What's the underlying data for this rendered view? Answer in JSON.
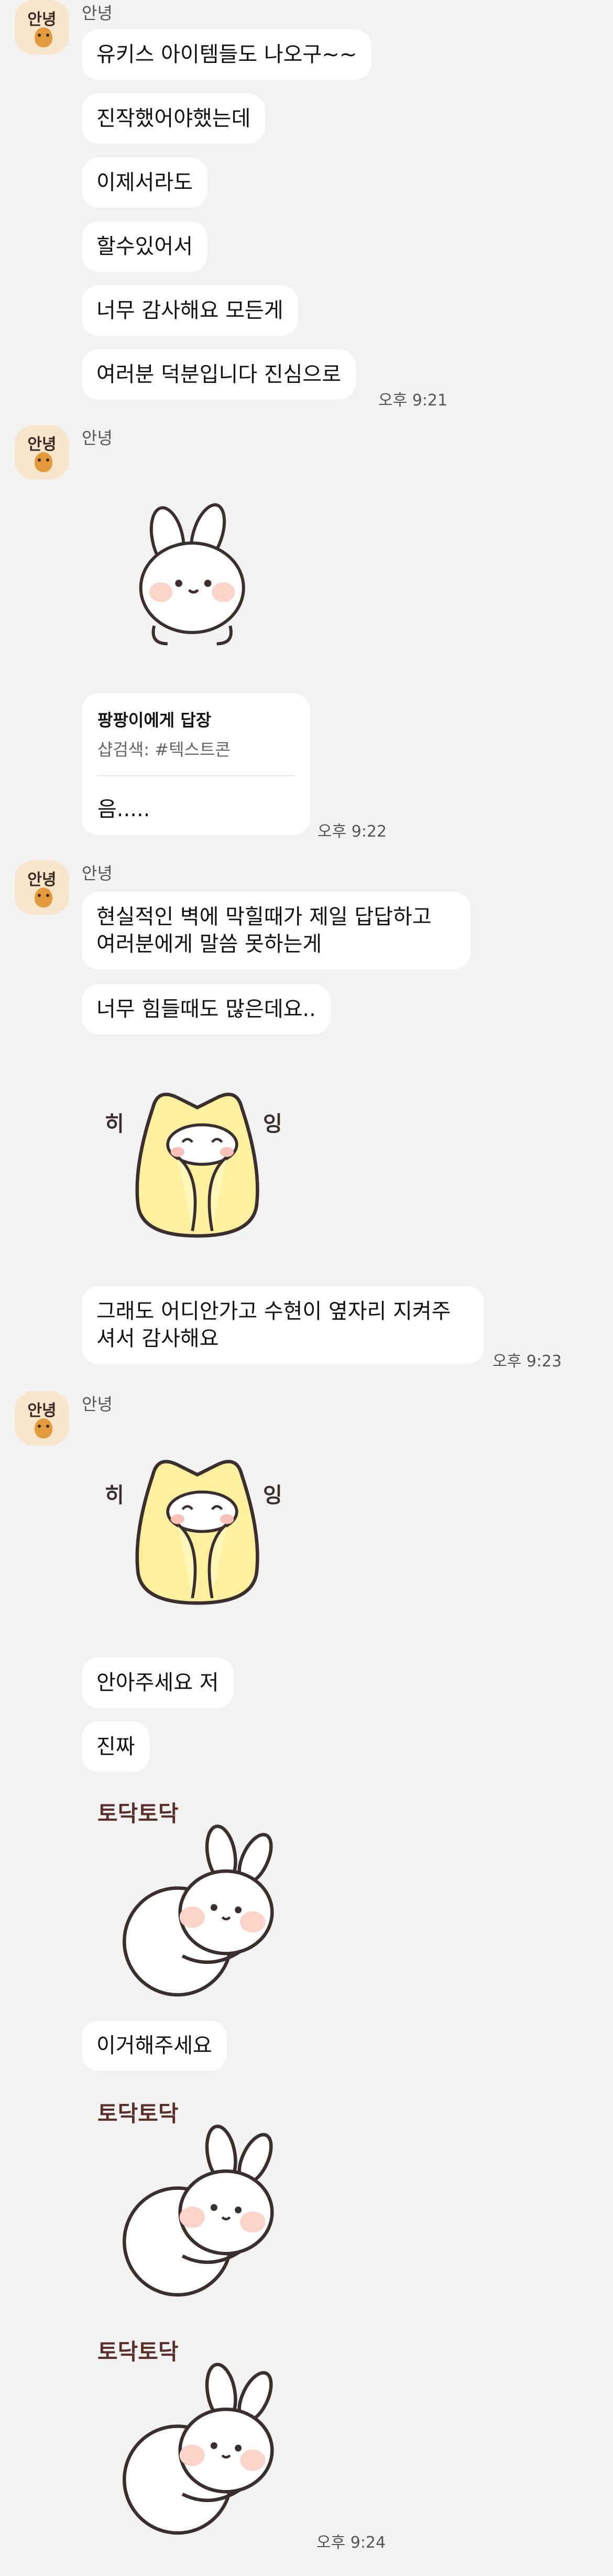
{
  "sender_name": "안녕",
  "avatar_label": "안녕",
  "sticker_hi_left": "히",
  "sticker_hi_right": "잉",
  "sticker_todak": "토닥토닥",
  "group1": {
    "messages": [
      "유키스 아이템들도 나오구~~",
      "진작했어야했는데",
      "이제서라도",
      "할수있어서",
      "너무 감사해요 모든게",
      "여러분 덕분입니다 진심으로"
    ],
    "time": "오후 9:21"
  },
  "group2": {
    "reply_to": "팡팡이에게 답장",
    "reply_quote": "샵검색: #텍스트콘",
    "reply_text": "음.....",
    "time": "오후 9:22"
  },
  "group3": {
    "msg1_line1": "현실적인 벽에 막힐때가 제일 답답하고",
    "msg1_line2": "여러분에게 말씀 못하는게",
    "msg2": "너무 힘들때도 많은데요..",
    "msg3_line1": "그래도 어디안가고 수현이 옆자리 지켜주",
    "msg3_line2": "셔서 감사해요",
    "time": "오후 9:23"
  },
  "group4": {
    "msg1": "안아주세요 저",
    "msg2": "진짜",
    "msg3": "이거해주세요",
    "time": "오후 9:24"
  }
}
